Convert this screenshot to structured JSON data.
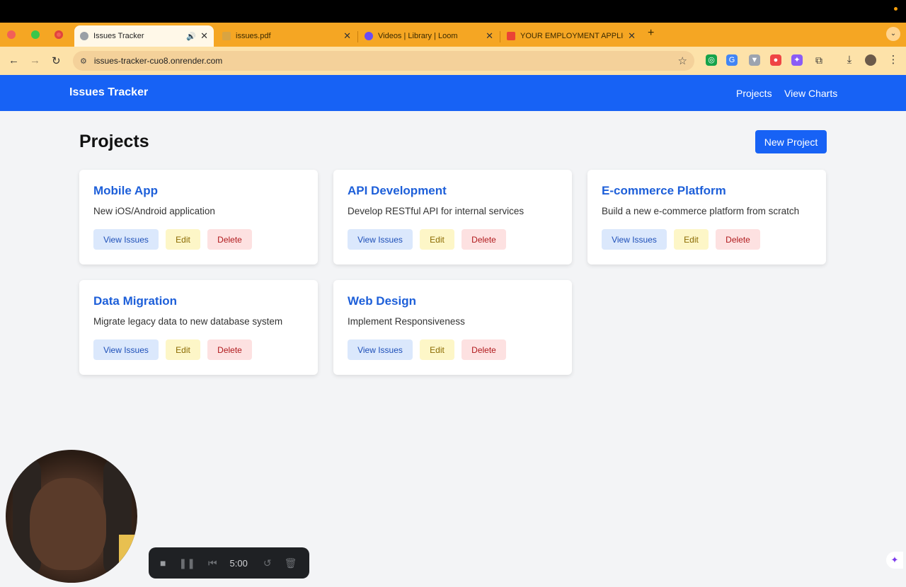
{
  "browser": {
    "tabs": [
      {
        "title": "Issues Tracker",
        "active": true
      },
      {
        "title": "issues.pdf",
        "active": false
      },
      {
        "title": "Videos | Library | Loom",
        "active": false
      },
      {
        "title": "YOUR EMPLOYMENT APPLIC",
        "active": false
      }
    ],
    "url": "issues-tracker-cuo8.onrender.com",
    "accent": "#f5a623"
  },
  "app": {
    "brand": "Issues Tracker",
    "nav": {
      "projects": "Projects",
      "charts": "View Charts"
    },
    "primary_color": "#1762f5"
  },
  "page": {
    "title": "Projects",
    "new_button": "New Project"
  },
  "actions": {
    "view": "View Issues",
    "edit": "Edit",
    "delete": "Delete"
  },
  "projects": [
    {
      "name": "Mobile App",
      "description": "New iOS/Android application"
    },
    {
      "name": "API Development",
      "description": "Develop RESTful API for internal services"
    },
    {
      "name": "E-commerce Platform",
      "description": "Build a new e-commerce platform from scratch"
    },
    {
      "name": "Data Migration",
      "description": "Migrate legacy data to new database system"
    },
    {
      "name": "Web Design",
      "description": "Implement Responsiveness"
    }
  ],
  "recorder": {
    "time": "5:00"
  }
}
